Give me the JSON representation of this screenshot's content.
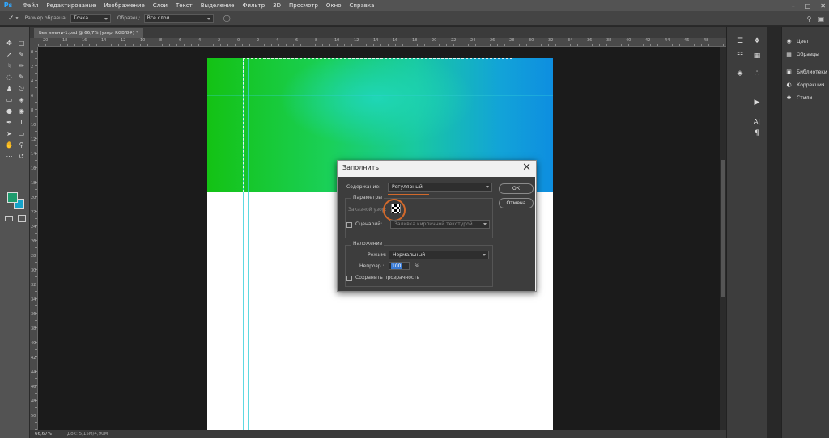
{
  "app": {
    "logo": "Ps",
    "menu": [
      "Файл",
      "Редактирование",
      "Изображение",
      "Слои",
      "Текст",
      "Выделение",
      "Фильтр",
      "3D",
      "Просмотр",
      "Окно",
      "Справка"
    ]
  },
  "options_bar": {
    "sample_size_label": "Размер образца:",
    "sample_size_value": "Точка",
    "sample_label": "Образец:",
    "sample_value": "Все слои"
  },
  "document": {
    "tab_title": "Без имени-1.psd @ 66,7% (узор, RGB/8#) *",
    "zoom": "66,67%",
    "doc_info": "Док: 5,15М/4,90М",
    "top_ruler_labels": [
      "20",
      "18",
      "16",
      "14",
      "12",
      "10",
      "8",
      "6",
      "4",
      "2",
      "0",
      "2",
      "4",
      "6",
      "8",
      "10",
      "12",
      "14",
      "16",
      "18",
      "20",
      "22",
      "24",
      "26",
      "28",
      "30",
      "32",
      "34",
      "36",
      "38",
      "40",
      "42",
      "44",
      "46",
      "48"
    ],
    "left_ruler_labels": [
      "0",
      "2",
      "4",
      "6",
      "8",
      "10",
      "12",
      "14",
      "16",
      "18",
      "20",
      "22",
      "24",
      "26",
      "28",
      "30",
      "32",
      "34",
      "36",
      "38",
      "40",
      "42",
      "44",
      "46",
      "48",
      "50"
    ]
  },
  "right_panels": {
    "items": [
      {
        "icon": "palette-icon",
        "label": "Цвет"
      },
      {
        "icon": "grid-icon",
        "label": "Образцы"
      },
      {
        "icon": "libraries-icon",
        "label": "Библиотеки"
      },
      {
        "icon": "adjustments-icon",
        "label": "Коррекция"
      },
      {
        "icon": "styles-icon",
        "label": "Стили"
      }
    ]
  },
  "dialog": {
    "title": "Заполнить",
    "content_label": "Содержание:",
    "content_value": "Регулярный",
    "params_label": "Параметры",
    "custom_pattern_label": "Заказной узор:",
    "script_label": "Сценарий:",
    "script_value": "Заливка кирпичной текстурой",
    "blending_label": "Наложение",
    "mode_label": "Режим:",
    "mode_value": "Нормальный",
    "opacity_label": "Непрозр.:",
    "opacity_value": "100",
    "opacity_unit": "%",
    "preserve_transparency_label": "Сохранить прозрачность",
    "ok_label": "ОК",
    "cancel_label": "Отмена"
  },
  "colors": {
    "foreground": "#1f9c6e",
    "background": "#15a3c9",
    "accent": "#d2692b"
  }
}
